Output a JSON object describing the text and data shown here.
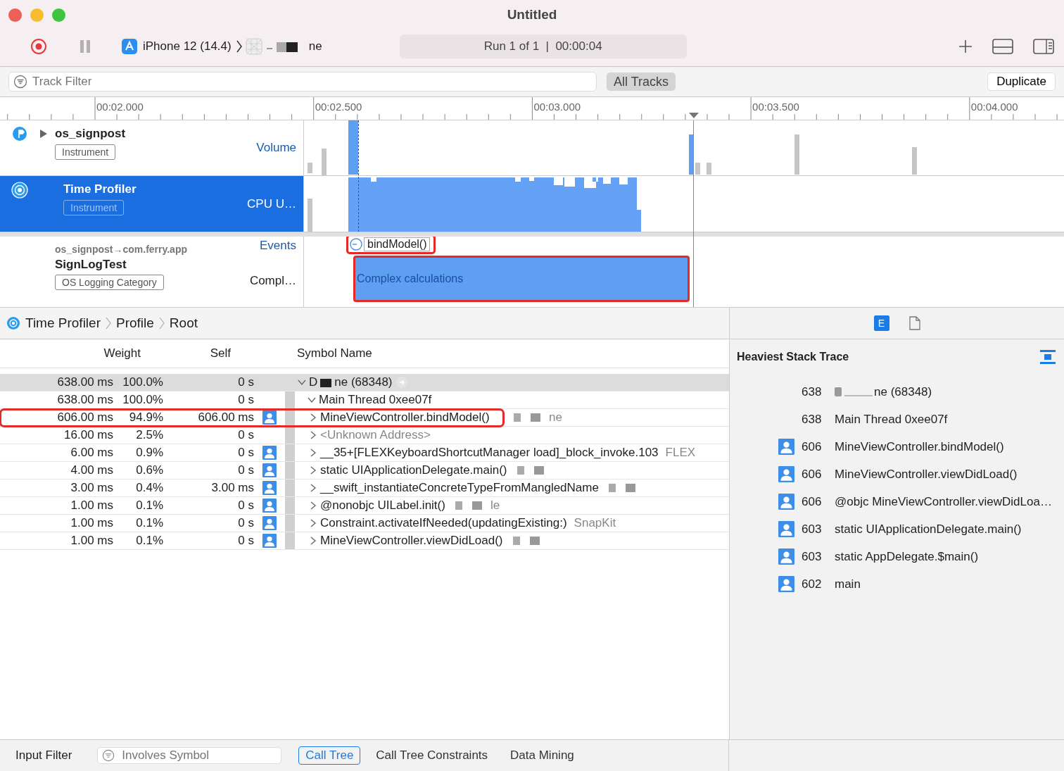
{
  "window": {
    "title": "Untitled"
  },
  "toolbar": {
    "device": "iPhone 12 (14.4)",
    "target": "ne",
    "run_status": "Run 1 of 1  |  00:00:04"
  },
  "filter_bar": {
    "placeholder": "Track Filter",
    "scope": {
      "label": "All Tracks",
      "selected": true
    },
    "button": "Duplicate"
  },
  "ruler": {
    "labels": [
      "00:02.000",
      "00:02.500",
      "00:03.000",
      "00:03.500",
      "00:04.000"
    ]
  },
  "tracks": [
    {
      "kind": "instrument",
      "name": "os_signpost",
      "tag": "Instrument",
      "lane": "Volume",
      "selected": false
    },
    {
      "kind": "instrument",
      "name": "Time Profiler",
      "tag": "Instrument",
      "lane": "CPU U…",
      "selected": true
    },
    {
      "kind": "signpost",
      "subtitle": "os_signpost→com.ferry.app",
      "name": "SignLogTest",
      "tag": "OS Logging Category",
      "lanes": [
        "Events",
        "Compl…"
      ],
      "event": "bindModel()",
      "interval": "Complex calculations"
    }
  ],
  "breadcrumb": [
    "Time Profiler",
    "Profile",
    "Root"
  ],
  "columns": [
    "Weight",
    "Self",
    "Symbol Name"
  ],
  "rows": [
    {
      "weight": "638.00 ms",
      "percent": "100.0%",
      "self": "0 s",
      "user_code": false,
      "prefix": "D",
      "symbol": "ne (68348)",
      "redacted": true,
      "selected": true,
      "expanded": true,
      "children": [
        {
          "weight": "638.00 ms",
          "percent": "100.0%",
          "self": "0 s",
          "user_code": false,
          "symbol": "Main Thread  0xee07f",
          "redacted": false,
          "selected": false,
          "expanded": true,
          "children": [
            {
              "weight": "606.00 ms",
              "percent": "94.9%",
              "self": "606.00 ms",
              "user_code": true,
              "symbol": "MineViewController.bindModel()",
              "library": "ne",
              "redacted": true,
              "selected": false,
              "expanded": false,
              "highlighted": true
            },
            {
              "weight": "16.00 ms",
              "percent": "2.5%",
              "self": "0 s",
              "user_code": false,
              "symbol": "<Unknown Address>",
              "redacted": false,
              "selected": false,
              "expanded": false,
              "dimmed": true
            },
            {
              "weight": "6.00 ms",
              "percent": "0.9%",
              "self": "0 s",
              "user_code": true,
              "symbol": "__35+[FLEXKeyboardShortcutManager load]_block_invoke.103",
              "library": "FLEX",
              "redacted": false,
              "selected": false,
              "expanded": false
            },
            {
              "weight": "4.00 ms",
              "percent": "0.6%",
              "self": "0 s",
              "user_code": true,
              "symbol": "static UIApplicationDelegate.main()",
              "redacted": true,
              "selected": false,
              "expanded": false
            },
            {
              "weight": "3.00 ms",
              "percent": "0.4%",
              "self": "3.00 ms",
              "user_code": true,
              "symbol": "__swift_instantiateConcreteTypeFromMangledName",
              "redacted": true,
              "selected": false,
              "expanded": false
            },
            {
              "weight": "1.00 ms",
              "percent": "0.1%",
              "self": "0 s",
              "user_code": true,
              "symbol": "@nonobjc UILabel.init()",
              "library": "le",
              "redacted": true,
              "selected": false,
              "expanded": false
            },
            {
              "weight": "1.00 ms",
              "percent": "0.1%",
              "self": "0 s",
              "user_code": true,
              "symbol": "Constraint.activateIfNeeded(updatingExisting:)",
              "library": "SnapKit",
              "redacted": false,
              "selected": false,
              "expanded": false
            },
            {
              "weight": "1.00 ms",
              "percent": "0.1%",
              "self": "0 s",
              "user_code": true,
              "symbol": "MineViewController.viewDidLoad()",
              "redacted": true,
              "selected": false,
              "expanded": false
            }
          ]
        }
      ]
    }
  ],
  "inspector": {
    "tabs": [
      {
        "kind": "extended",
        "label": "E",
        "selected": true
      },
      {
        "kind": "document",
        "selected": false
      }
    ],
    "title": "Heaviest Stack Trace",
    "frames": [
      {
        "count": "638",
        "symbol": "ne (68348)",
        "redacted": true,
        "user_code": false
      },
      {
        "count": "638",
        "symbol": "Main Thread  0xee07f",
        "redacted": false,
        "user_code": false
      },
      {
        "count": "606",
        "symbol": "MineViewController.bindModel()",
        "redacted": false,
        "user_code": true
      },
      {
        "count": "606",
        "symbol": "MineViewController.viewDidLoad()",
        "redacted": false,
        "user_code": true
      },
      {
        "count": "606",
        "symbol": "@objc MineViewController.viewDidLoa…",
        "redacted": false,
        "user_code": true
      },
      {
        "count": "603",
        "symbol": "static UIApplicationDelegate.main()",
        "redacted": false,
        "user_code": true
      },
      {
        "count": "603",
        "symbol": "static AppDelegate.$main()",
        "redacted": false,
        "user_code": true
      },
      {
        "count": "602",
        "symbol": "main",
        "redacted": false,
        "user_code": true
      }
    ]
  },
  "bottom_bar": {
    "label": "Input Filter",
    "placeholder": "Involves Symbol",
    "tabs": [
      {
        "label": "Call Tree",
        "selected": true
      },
      {
        "label": "Call Tree Constraints",
        "selected": false
      },
      {
        "label": "Data Mining",
        "selected": false
      }
    ]
  }
}
